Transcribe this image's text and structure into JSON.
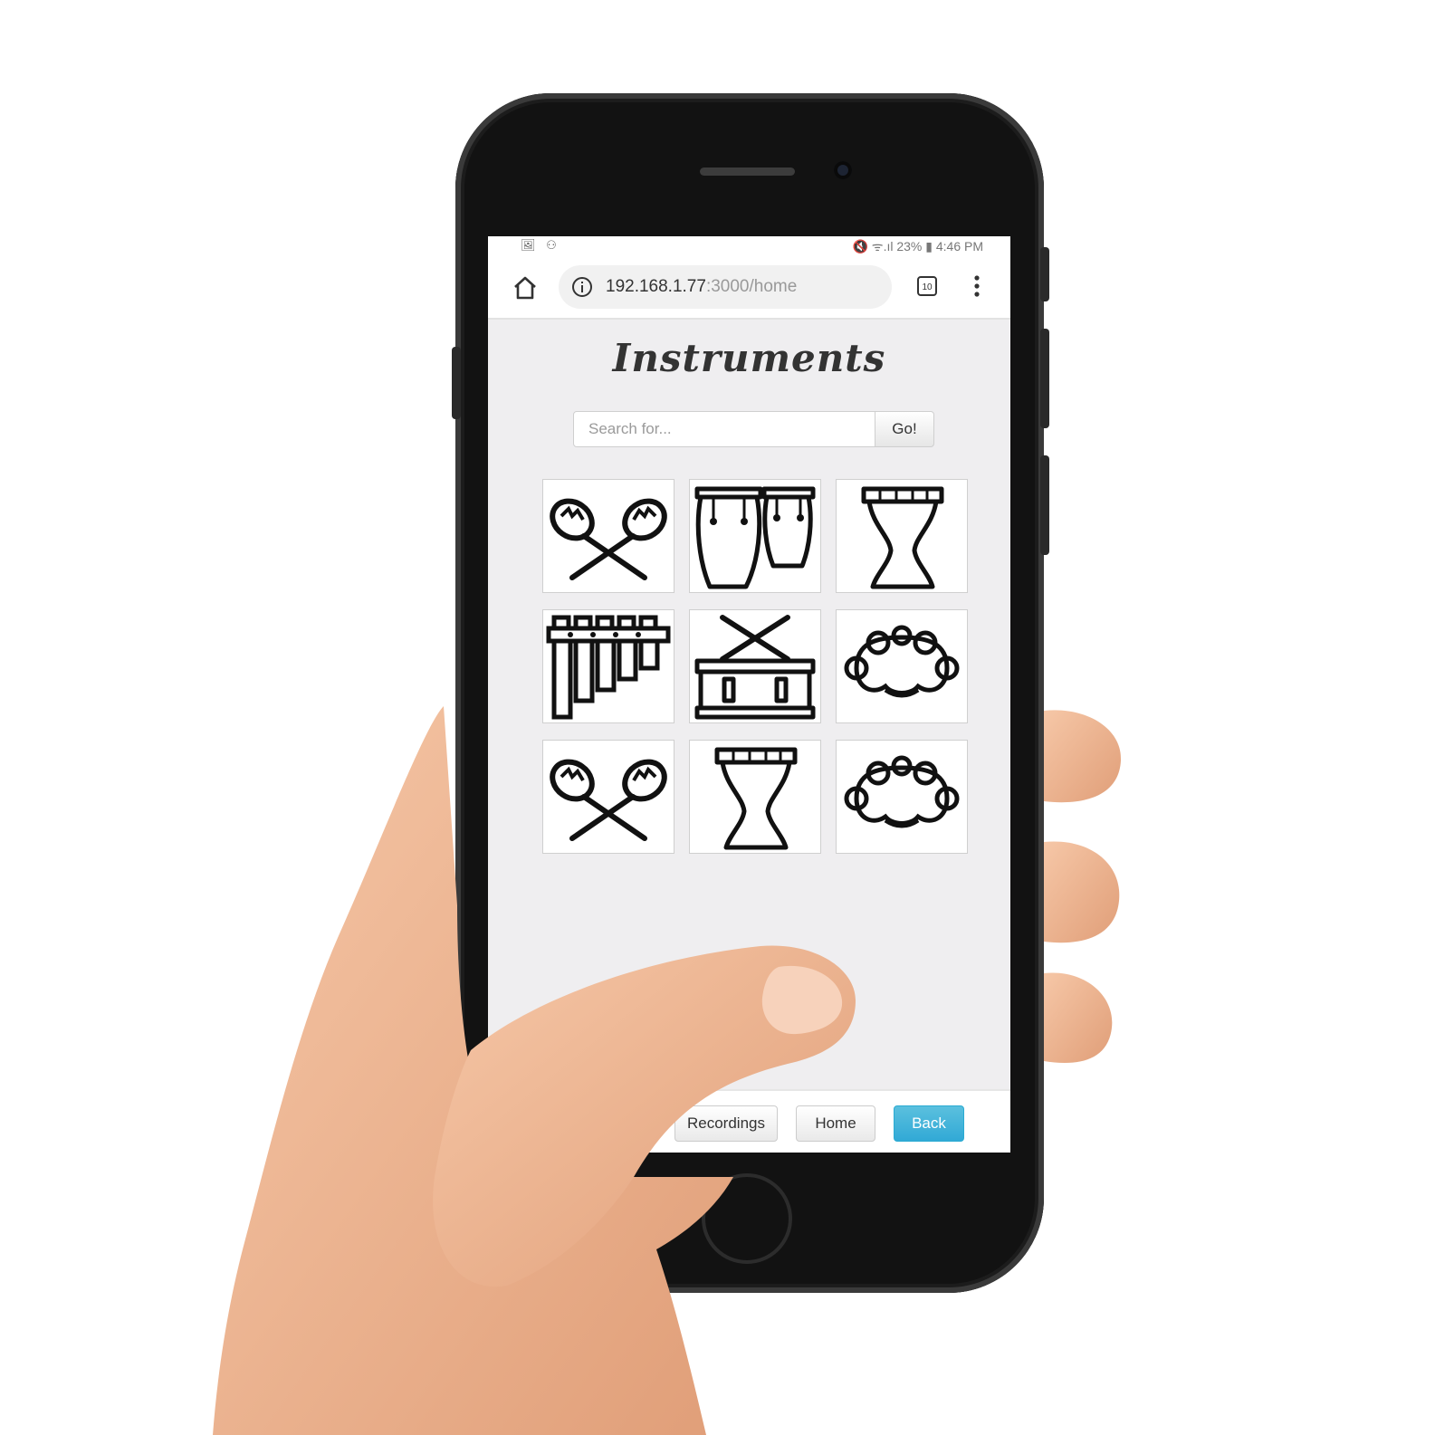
{
  "status_bar": {
    "left_icons": "🖼 ⚇",
    "right_text": "🔇 ᯤ.ıl 23% ▮ 4:46 PM"
  },
  "browser": {
    "url_host": "192.168.1.77",
    "url_path": ":3000/home",
    "tab_count": "10"
  },
  "page": {
    "title": "Instruments",
    "search": {
      "placeholder": "Search for...",
      "go_label": "Go!"
    },
    "instruments": [
      {
        "icon": "maracas-icon"
      },
      {
        "icon": "conga-drums-icon"
      },
      {
        "icon": "djembe-icon"
      },
      {
        "icon": "marimba-icon"
      },
      {
        "icon": "snare-drum-icon"
      },
      {
        "icon": "tambourine-icon"
      },
      {
        "icon": "maracas-icon"
      },
      {
        "icon": "djembe-icon"
      },
      {
        "icon": "tambourine-icon"
      }
    ]
  },
  "footer": {
    "recordings_label": "Recordings",
    "home_label": "Home",
    "back_label": "Back"
  },
  "colors": {
    "primary_button": "#31a9d6",
    "page_background": "#efeef0",
    "skin": "#f0b996"
  }
}
